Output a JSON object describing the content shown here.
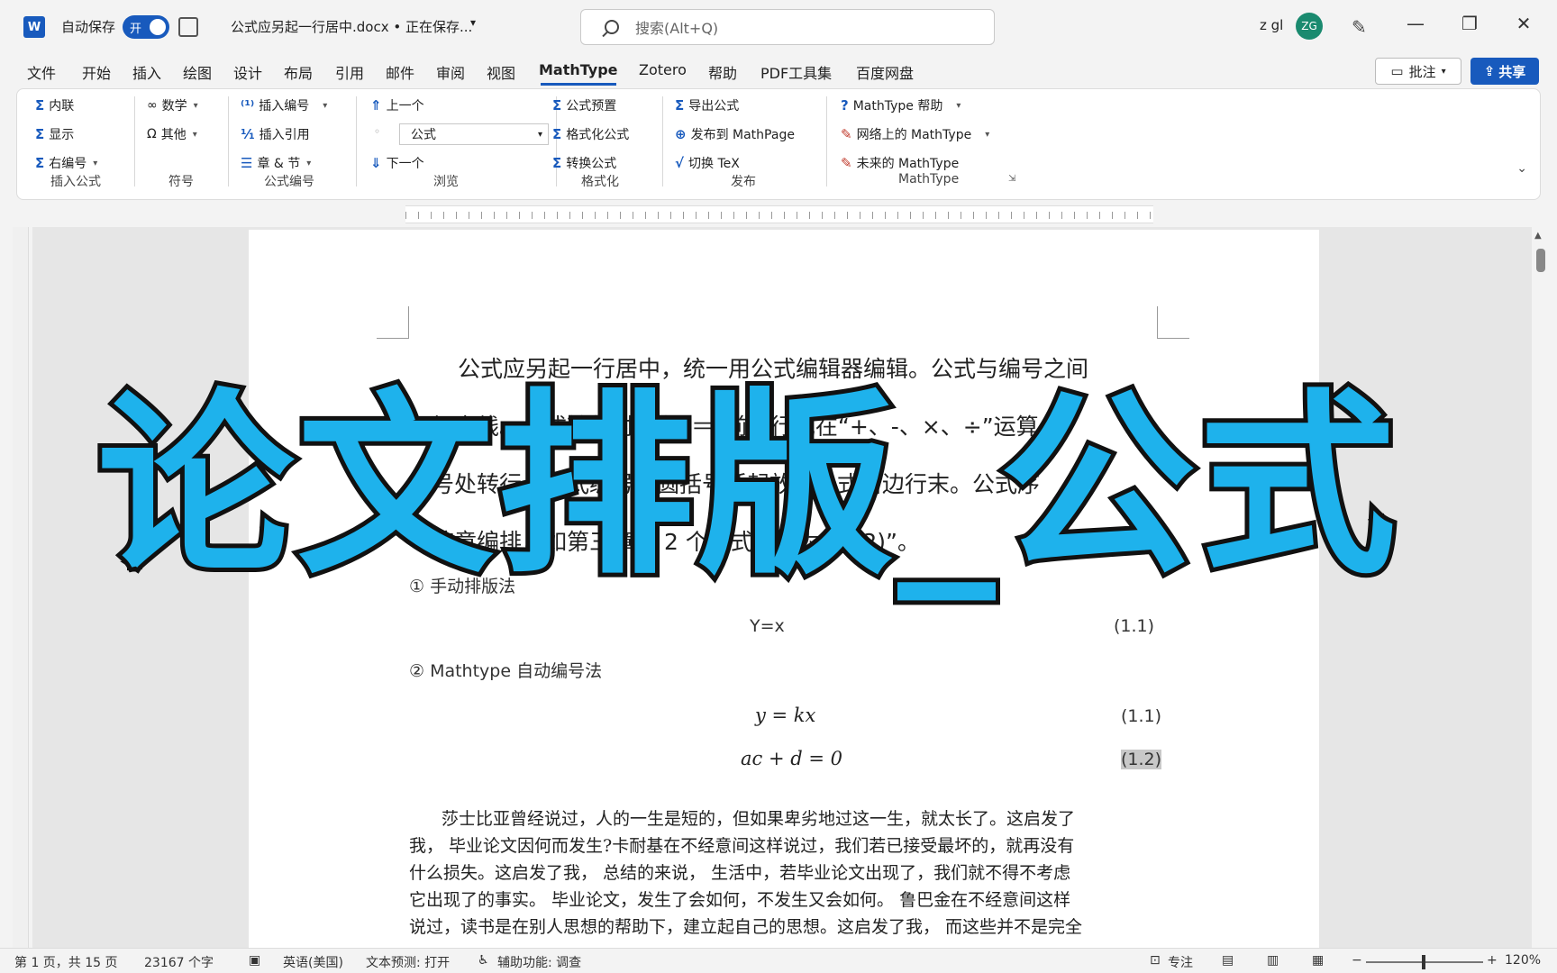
{
  "titlebar": {
    "logo": "W",
    "autosave_label": "自动保存",
    "autosave_state": "开",
    "doc_title": "公式应另起一行居中.docx • 正在保存...",
    "search_placeholder": "搜索(Alt+Q)",
    "user_name": "z gl",
    "avatar_initials": "ZG"
  },
  "menu": {
    "items": [
      "文件",
      "开始",
      "插入",
      "绘图",
      "设计",
      "布局",
      "引用",
      "邮件",
      "审阅",
      "视图",
      "MathType",
      "Zotero",
      "帮助",
      "PDF工具集",
      "百度网盘"
    ],
    "active": "MathType",
    "comment_label": "批注",
    "share_label": "共享"
  },
  "ribbon": {
    "insert_equation": {
      "label": "插入公式",
      "inline": "内联",
      "display": "显示",
      "right_numbered": "右编号"
    },
    "symbols": {
      "label": "符号",
      "math": "数学",
      "other": "其他"
    },
    "equation_numbers": {
      "label": "公式编号",
      "insert_number": "插入编号",
      "insert_reference": "插入引用",
      "chapters_sections": "章 & 节"
    },
    "browse": {
      "label": "浏览",
      "previous": "上一个",
      "style_value": "公式",
      "next": "下一个"
    },
    "format": {
      "label": "格式化",
      "presets": "公式预置",
      "format_equations": "格式化公式",
      "convert": "转换公式"
    },
    "publish": {
      "label": "发布",
      "export": "导出公式",
      "publish_mathpage": "发布到 MathPage",
      "toggle_tex": "切换 TeX"
    },
    "mathtype": {
      "label": "MathType",
      "help": "MathType 帮助",
      "on_web": "网络上的 MathType",
      "future": "未来的 MathType"
    }
  },
  "document": {
    "para1_line1": "公式应另起一行居中，统一用公式编辑器编辑。公式与编号之间",
    "para1_line2": "不加虚线。公式较长时应在“＝”前转行或在“+、-、×、÷”运算",
    "para1_line3": "符号处转行。公式编号用圆括号括起放在公式右边行末。公式序",
    "para1_line4": "号按章编排，如第三章第 2 个公式序号为“(3.2)”。",
    "method1_label": "① 手动排版法",
    "eq_manual": "Y=x",
    "eq_manual_num": "(1.1)",
    "method2_label": "② Mathtype 自动编号法",
    "eq1": "y = kx",
    "eq1_num": "(1.1)",
    "eq2": "ac + d = 0",
    "eq2_num": "(1.2)",
    "body_line1": "莎士比亚曾经说过，人的一生是短的，但如果卑劣地过这一生，就太长了。这启发了",
    "body_line2": "我， 毕业论文因何而发生?卡耐基在不经意间这样说过，我们若已接受最坏的，就再没有",
    "body_line3": "什么损失。这启发了我， 总结的来说， 生活中，若毕业论文出现了，我们就不得不考虑",
    "body_line4": "它出现了的事实。 毕业论文，发生了会如何，不发生又会如何。 鲁巴金在不经意间这样",
    "body_line5": "说过，读书是在别人思想的帮助下，建立起自己的思想。这启发了我， 而这些并不是完全"
  },
  "overlay_title": "论文排版_公式",
  "statusbar": {
    "page": "第 1 页，共 15 页",
    "words": "23167 个字",
    "language": "英语(美国)",
    "predictions": "文本预测: 打开",
    "accessibility": "辅助功能: 调查",
    "focus": "专注",
    "zoom": "120%"
  }
}
